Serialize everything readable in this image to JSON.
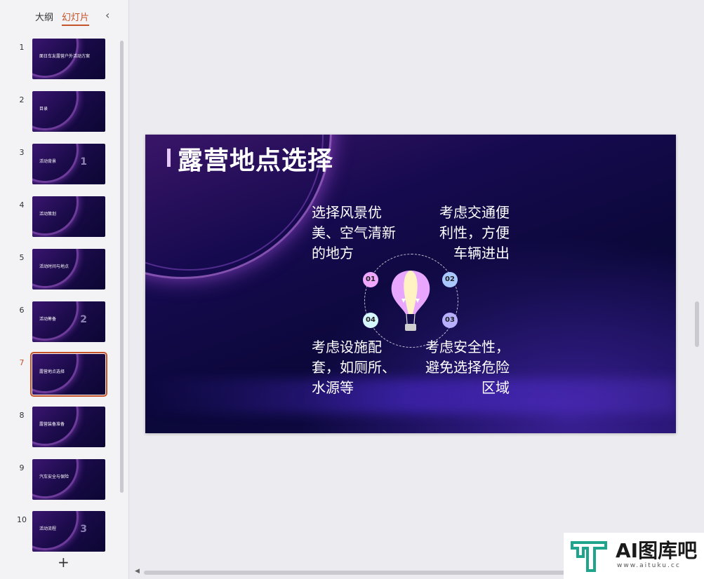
{
  "panel": {
    "tabs": [
      {
        "label": "大纲"
      },
      {
        "label": "幻灯片"
      }
    ],
    "thumbnails": [
      {
        "num": "1",
        "text": "面日车友露营户外活动方案"
      },
      {
        "num": "2",
        "text": "目录"
      },
      {
        "num": "3",
        "text": "活动背景",
        "big": "1"
      },
      {
        "num": "4",
        "text": "活动策划"
      },
      {
        "num": "5",
        "text": "活动时间与地点"
      },
      {
        "num": "6",
        "text": "活动筹备",
        "big": "2"
      },
      {
        "num": "7",
        "text": "露营地点选择"
      },
      {
        "num": "8",
        "text": "露营装备准备"
      },
      {
        "num": "9",
        "text": "汽车安全与保险"
      },
      {
        "num": "10",
        "text": "活动流程",
        "big": "3"
      }
    ],
    "add_label": "+"
  },
  "slide": {
    "title": "露营地点选择",
    "blocks": [
      "选择风景优美、空气清新的地方",
      "考虑交通便利性，方便车辆进出",
      "考虑设施配套，如厕所、水源等",
      "考虑安全性，避免选择危险区域"
    ],
    "badges": [
      "01",
      "02",
      "03",
      "04"
    ],
    "badge_colors": [
      "#f0a8ff",
      "#a9c8ff",
      "#b7b0ff",
      "#d7f7ff"
    ]
  },
  "watermark": {
    "text": "AI图库吧",
    "sub": "www.aituku.cc"
  }
}
